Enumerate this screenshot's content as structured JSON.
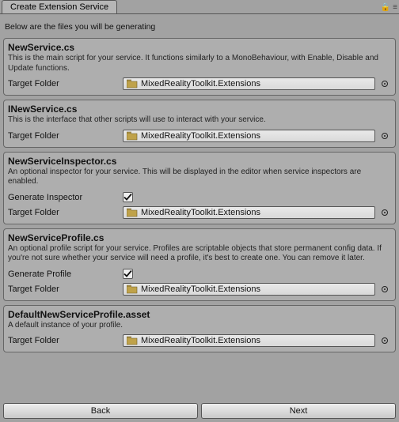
{
  "tab_title": "Create Extension Service",
  "intro": "Below are the files you will be generating",
  "folder_value": "MixedRealityToolkit.Extensions",
  "labels": {
    "target_folder": "Target Folder"
  },
  "groups": [
    {
      "title": "NewService.cs",
      "desc": "This is the main script for your service. It functions similarly to a MonoBehaviour, with Enable, Disable and Update functions.",
      "check_label": null,
      "checked": null
    },
    {
      "title": "INewService.cs",
      "desc": "This is the interface that other scripts will use to interact with your service.",
      "check_label": null,
      "checked": null
    },
    {
      "title": "NewServiceInspector.cs",
      "desc": "An optional inspector for your service. This will be displayed in the editor when service inspectors are enabled.",
      "check_label": "Generate Inspector",
      "checked": true
    },
    {
      "title": "NewServiceProfile.cs",
      "desc": "An optional profile script for your service. Profiles are scriptable objects that store permanent config data. If you're not sure whether your service will need a profile, it's best to create one. You can remove it later.",
      "check_label": "Generate Profile",
      "checked": true
    },
    {
      "title": "DefaultNewServiceProfile.asset",
      "desc": "A default instance of your profile.",
      "check_label": null,
      "checked": null
    }
  ],
  "buttons": {
    "back": "Back",
    "next": "Next"
  }
}
